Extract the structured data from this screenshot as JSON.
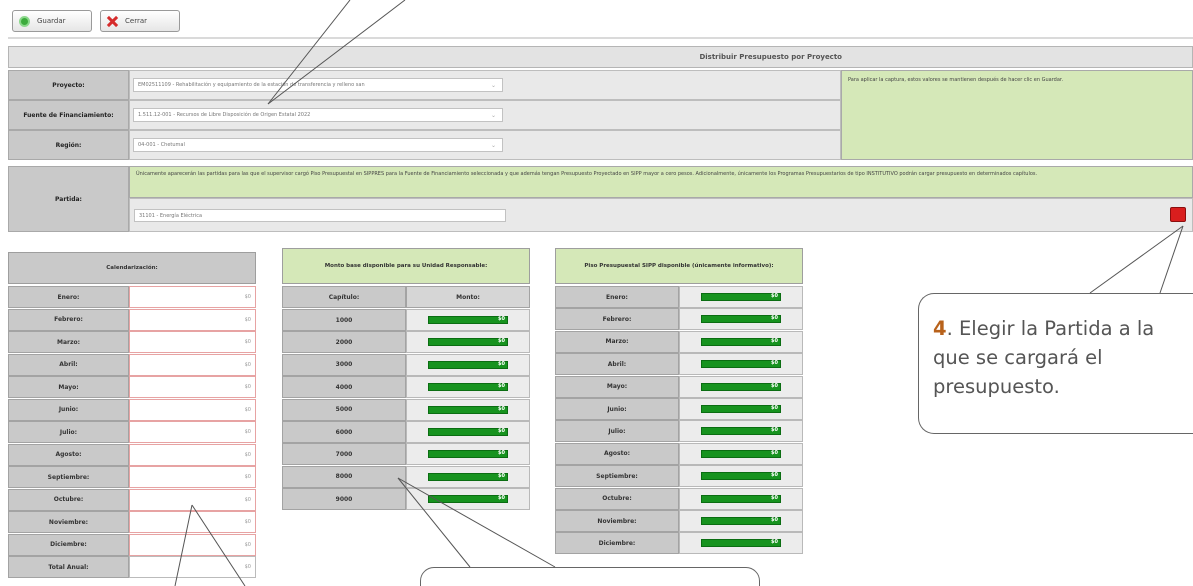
{
  "toolbar": {
    "save_label": "Guardar",
    "close_label": "Cerrar"
  },
  "panel": {
    "title": "Distribuir Presupuesto por Proyecto",
    "proyecto_label": "Proyecto:",
    "proyecto_value": "EM02511109 - Rehabilitación y equipamiento de la estación de transferencia y relleno san",
    "fuente_label": "Fuente de Financiamiento:",
    "fuente_value": "1.511.12-001 - Recursos de Libre Disposición de Origen Estatal 2022",
    "region_label": "Región:",
    "region_value": "04-001 - Chetumal",
    "info_note": "Para aplicar la captura, estos valores se mantienen después de hacer clic en Guardar.",
    "partida_label": "Partida:",
    "partida_note": "Únicamente aparecerán las partidas para las que el supervisor cargó Piso Presupuestal en SIPPRES para la Fuente de Financiamiento seleccionada y que además tengan Presupuesto Proyectado en SIPP mayor a cero pesos. Adicionalmente, únicamente los Programas Presupuestarios de tipo INSTITUTIVO podrán cargar presupuesto en determinados capítulos.",
    "partida_value": "31101 - Energía Eléctrica"
  },
  "calendar": {
    "header": "Calendarización:",
    "months": [
      "Enero:",
      "Febrero:",
      "Marzo:",
      "Abril:",
      "Mayo:",
      "Junio:",
      "Julio:",
      "Agosto:",
      "Septiembre:",
      "Octubre:",
      "Noviembre:",
      "Diciembre:"
    ],
    "total_label": "Total Anual:",
    "input_value": "$0"
  },
  "available": {
    "header": "Monto base disponible para su Unidad Responsable:",
    "col_capitulo": "Capítulo:",
    "col_monto": "Monto:",
    "chapters": [
      "1000",
      "2000",
      "3000",
      "4000",
      "5000",
      "6000",
      "7000",
      "8000",
      "9000"
    ],
    "bar_value": "$0"
  },
  "piso": {
    "header": "Piso Presupuestal SIPP disponible (únicamente informativo):",
    "months": [
      "Enero:",
      "Febrero:",
      "Marzo:",
      "Abril:",
      "Mayo:",
      "Junio:",
      "Julio:",
      "Agosto:",
      "Septiembre:",
      "Octubre:",
      "Noviembre:",
      "Diciembre:"
    ],
    "bar_value": "$0"
  },
  "callout": {
    "number": "4",
    "text": ". Elegir la Partida a la que se cargará el presupuesto."
  },
  "colors": {
    "accent": "#b8621b",
    "bar": "#17931f",
    "note_green": "#d5e8b8"
  },
  "icons": [
    "check-circle-icon",
    "close-x-icon",
    "delete-red-icon"
  ]
}
